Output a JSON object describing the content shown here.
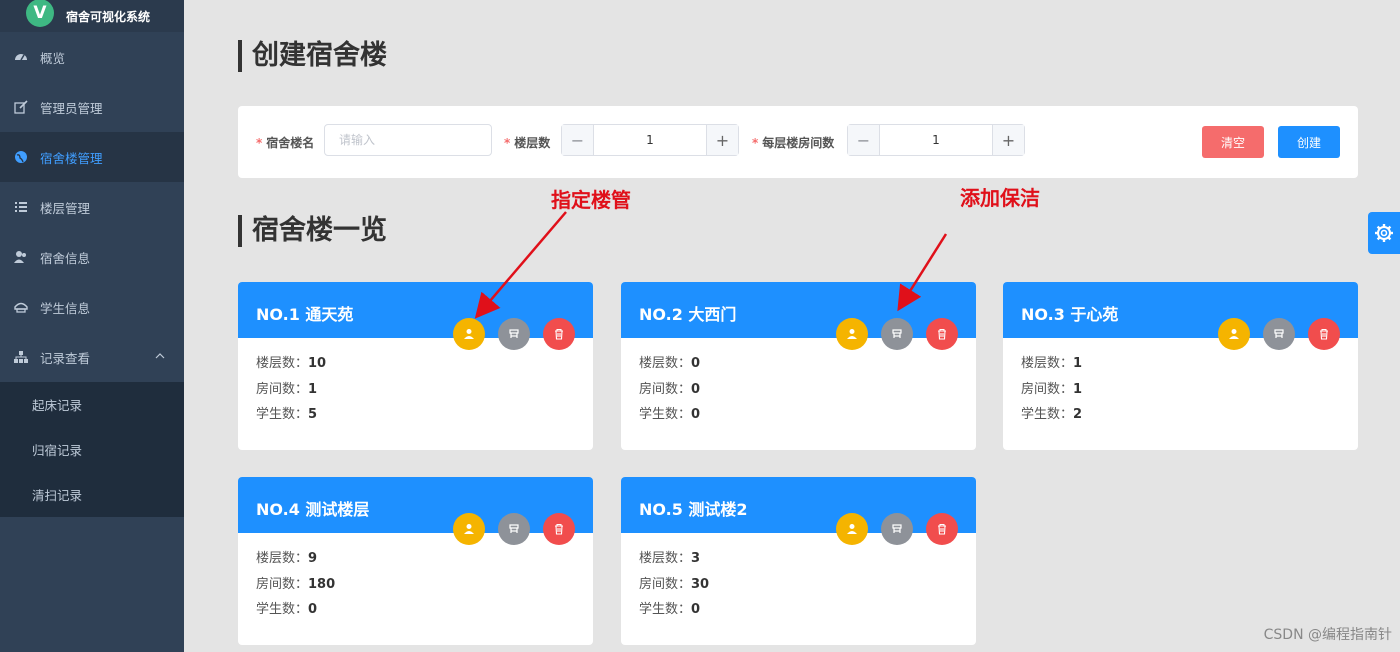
{
  "app": {
    "logo_letter": "V",
    "title": "宿舍可视化系统"
  },
  "sidebar": {
    "items": [
      {
        "label": "概览",
        "icon": "dashboard-icon"
      },
      {
        "label": "管理员管理",
        "icon": "edit-icon"
      },
      {
        "label": "宿舍楼管理",
        "icon": "globe-icon",
        "active": true
      },
      {
        "label": "楼层管理",
        "icon": "list-icon"
      },
      {
        "label": "宿舍信息",
        "icon": "users-icon"
      },
      {
        "label": "学生信息",
        "icon": "helmet-icon"
      },
      {
        "label": "记录查看",
        "icon": "sitemap-icon",
        "expanded": true
      }
    ],
    "subitems": [
      {
        "label": "起床记录"
      },
      {
        "label": "归宿记录"
      },
      {
        "label": "清扫记录"
      }
    ]
  },
  "create_section": {
    "title": "创建宿舍楼",
    "name_label": "宿舍楼名",
    "name_placeholder": "请输入",
    "floors_label": "楼层数",
    "floors_value": "1",
    "rooms_label": "每层楼房间数",
    "rooms_value": "1",
    "minus": "−",
    "plus": "+",
    "required_mark": "*",
    "clear_label": "清空",
    "create_label": "创建"
  },
  "list_section": {
    "title": "宿舍楼一览",
    "floors_key": "楼层数：",
    "rooms_key": "房间数：",
    "students_key": "学生数：",
    "buildings": [
      {
        "name": "NO.1 通天苑",
        "floors": "10",
        "rooms": "1",
        "students": "5"
      },
      {
        "name": "NO.2 大西门",
        "floors": "0",
        "rooms": "0",
        "students": "0"
      },
      {
        "name": "NO.3 于心苑",
        "floors": "1",
        "rooms": "1",
        "students": "2"
      },
      {
        "name": "NO.4 测试楼层",
        "floors": "9",
        "rooms": "180",
        "students": "0"
      },
      {
        "name": "NO.5 测试楼2",
        "floors": "3",
        "rooms": "30",
        "students": "0"
      }
    ]
  },
  "annotations": {
    "assign_manager": "指定楼管",
    "add_cleaner": "添加保洁"
  },
  "watermark": "CSDN @编程指南针",
  "colors": {
    "primary": "#1e90ff",
    "danger": "#f56c6c",
    "warning": "#f5b400",
    "gray": "#8e9299",
    "sidebar": "#304156",
    "annotation": "#e0101a"
  }
}
